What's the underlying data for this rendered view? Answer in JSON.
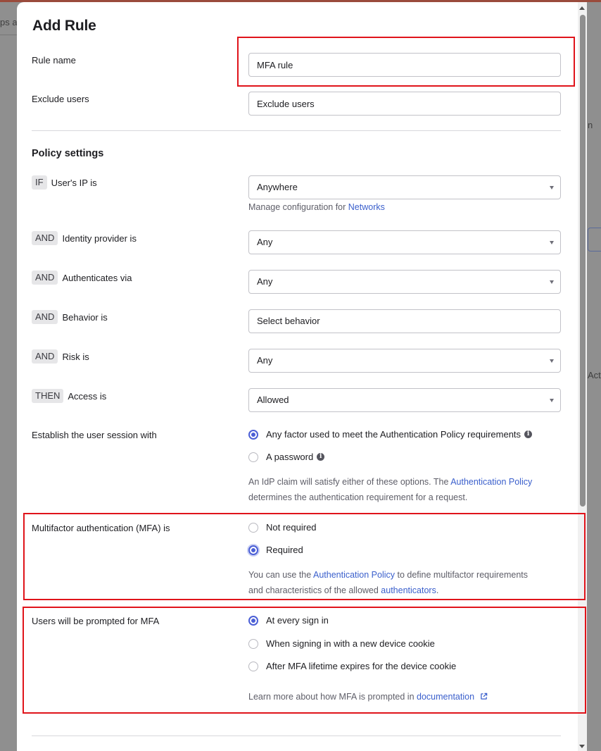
{
  "background": {
    "left_hint": "ps a",
    "right_hint_1": "n",
    "right_hint_2": "Acti"
  },
  "modal": {
    "title": "Add Rule"
  },
  "rule_name": {
    "label": "Rule name",
    "value": "MFA rule"
  },
  "exclude_users": {
    "label": "Exclude users",
    "placeholder": "Exclude users"
  },
  "policy_settings": {
    "title": "Policy settings",
    "conditions": [
      {
        "badge": "IF",
        "label": "User's IP is",
        "value": "Anywhere"
      },
      {
        "badge": "AND",
        "label": "Identity provider is",
        "value": "Any"
      },
      {
        "badge": "AND",
        "label": "Authenticates via",
        "value": "Any"
      },
      {
        "badge": "AND",
        "label": "Behavior is",
        "value": "Select behavior"
      },
      {
        "badge": "AND",
        "label": "Risk is",
        "value": "Any"
      },
      {
        "badge": "THEN",
        "label": "Access is",
        "value": "Allowed"
      }
    ],
    "networks_helper": "Manage configuration for ",
    "networks_link": "Networks"
  },
  "session": {
    "label": "Establish the user session with",
    "options": [
      {
        "label": "Any factor used to meet the Authentication Policy requirements",
        "selected": true
      },
      {
        "label": "A password",
        "selected": false
      }
    ],
    "helper_pre": "An IdP claim will satisfy either of these options. The ",
    "helper_link": "Authentication Policy",
    "helper_post": "determines the authentication requirement for a request."
  },
  "mfa": {
    "label": "Multifactor authentication (MFA) is",
    "options": [
      {
        "label": "Not required",
        "selected": false
      },
      {
        "label": "Required",
        "selected": true
      }
    ],
    "helper_pre": "You can use the ",
    "helper_link1": "Authentication Policy",
    "helper_mid": " to define multifactor requirements",
    "helper_line2_pre": "and characteristics of the allowed ",
    "helper_link2": "authenticators",
    "helper_end": "."
  },
  "prompt": {
    "label": "Users will be prompted for MFA",
    "options": [
      {
        "label": "At every sign in",
        "selected": true
      },
      {
        "label": "When signing in with a new device cookie",
        "selected": false
      },
      {
        "label": "After MFA lifetime expires for the device cookie",
        "selected": false
      }
    ],
    "helper_pre": "Learn more about how MFA is prompted in ",
    "helper_link": "documentation"
  },
  "colors": {
    "accent": "#4b5fd6",
    "link": "#3a5fcc",
    "highlight": "#e0141b"
  },
  "icons": {
    "info": "info-icon",
    "external_link": "external-link-icon",
    "dropdown": "chevron-down-icon"
  }
}
